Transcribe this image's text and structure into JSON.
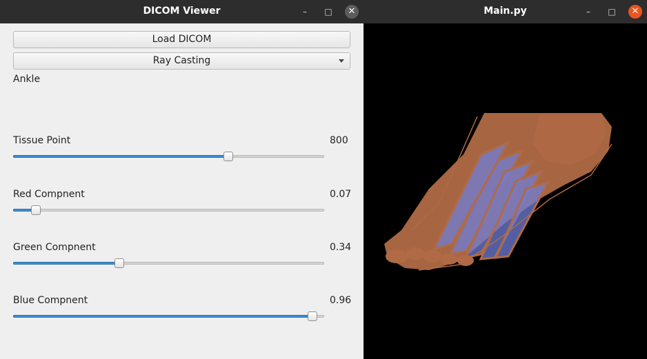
{
  "left_window": {
    "title": "DICOM Viewer",
    "minimize_glyph": "–",
    "maximize_glyph": "□",
    "close_glyph": "✕",
    "load_button": "Load DICOM",
    "render_mode": {
      "selected": "Ray Casting"
    },
    "dataset_label": "Ankle",
    "sliders": [
      {
        "label": "Tissue Point",
        "value_text": "800",
        "fraction": 0.69
      },
      {
        "label": "Red Compnent",
        "value_text": "0.07",
        "fraction": 0.07
      },
      {
        "label": "Green Compnent",
        "value_text": "0.34",
        "fraction": 0.34
      },
      {
        "label": "Blue Compnent",
        "value_text": "0.96",
        "fraction": 0.96
      }
    ]
  },
  "right_window": {
    "title": "Main.py",
    "minimize_glyph": "–",
    "maximize_glyph": "□",
    "close_glyph": "✕",
    "view": {
      "background": "#000000",
      "tissue_color": "#b06a45",
      "highlight_color": "#6f7ed8"
    }
  },
  "colors": {
    "slider_fill": "#3d8fd6",
    "close_active": "#e95420",
    "titlebar": "#2d2d2d"
  }
}
